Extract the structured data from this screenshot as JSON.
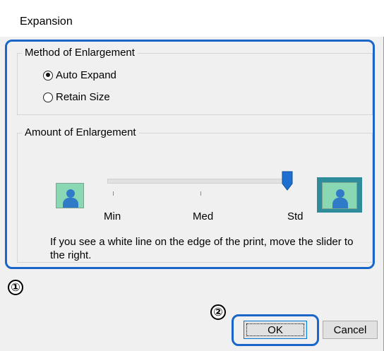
{
  "window": {
    "title": "Expansion"
  },
  "method_group": {
    "label": "Method of Enlargement",
    "options": [
      {
        "label": "Auto Expand",
        "checked": true
      },
      {
        "label": "Retain Size",
        "checked": false
      }
    ]
  },
  "amount_group": {
    "label": "Amount of Enlargement",
    "slider": {
      "ticks": [
        "Min",
        "Med",
        "Std"
      ],
      "selected": "Std",
      "left_icon": "small-image-icon",
      "right_icon": "expanded-image-icon"
    },
    "hint": "If you see a white line on the edge of the print, move the slider to the right."
  },
  "callouts": [
    "①",
    "②"
  ],
  "buttons": {
    "ok": "OK",
    "cancel": "Cancel"
  },
  "colors": {
    "highlight": "#1a66c8",
    "slider_thumb": "#1e6fd0",
    "dialog_bg": "#f0f0f0"
  }
}
